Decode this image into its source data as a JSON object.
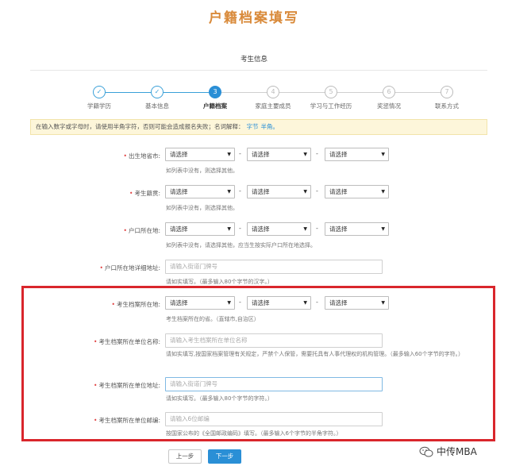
{
  "page": {
    "title": "户籍档案填写",
    "section": "考生信息"
  },
  "steps": [
    {
      "num": "✓",
      "label": "学籍学历",
      "state": "done"
    },
    {
      "num": "✓",
      "label": "基本信息",
      "state": "done"
    },
    {
      "num": "3",
      "label": "户籍档案",
      "state": "active"
    },
    {
      "num": "4",
      "label": "家庭主要成员",
      "state": "todo"
    },
    {
      "num": "5",
      "label": "学习与工作经历",
      "state": "todo"
    },
    {
      "num": "6",
      "label": "奖惩情况",
      "state": "todo"
    },
    {
      "num": "7",
      "label": "联系方式",
      "state": "todo"
    }
  ],
  "notice": {
    "text": "在输入数字或字母时，请使用半角字符，否则可能会造成报名失败；名词解释：",
    "link1": "字节",
    "link2": "半角。"
  },
  "select_placeholder": "请选择",
  "form": {
    "birthplace": {
      "label": "出生地省市:",
      "hint": "如列表中没有，则选择其他。"
    },
    "native_place": {
      "label": "考生籍贯:",
      "hint": "如列表中没有，则选择其他。"
    },
    "hukou": {
      "label": "户口所在地:",
      "hint": "如列表中没有，请选择其他，应当生按实际户口所在地选择。"
    },
    "hukou_address": {
      "label": "户口所在地详细地址:",
      "placeholder": "请输入街道门牌号",
      "hint": "请如实填写。（最多输入80个字节的汉字。）"
    },
    "archive_location": {
      "label": "考生档案所在地:",
      "hint": "考生档案所在的省。（直辖市,自治区）"
    },
    "archive_unit_name": {
      "label": "考生档案所在单位名称:",
      "placeholder": "请输入考生档案所在单位名称",
      "hint": "请如实填写,按国家档案管理有关规定，严禁个人保管，需要托具有人事代理权的机构管理。（最多输入60个字节的字符。）"
    },
    "archive_unit_address": {
      "label": "考生档案所在单位地址:",
      "placeholder": "请输入街道门牌号",
      "hint": "请如实填写。（最多输入80个字节的字符。）"
    },
    "archive_unit_postcode": {
      "label": "考生档案所在单位邮编:",
      "placeholder": "请输入6位邮编",
      "hint": "按国家公布的《全国邮政编码》填写。（最多输入6个字节的半角字符。）"
    }
  },
  "buttons": {
    "prev": "上一步",
    "next": "下一步"
  },
  "watermark": "中传MBA",
  "colors": {
    "accent": "#2a8fd6",
    "title": "#d98a3a",
    "highlight_border": "#d9262c",
    "required": "#e04040"
  }
}
